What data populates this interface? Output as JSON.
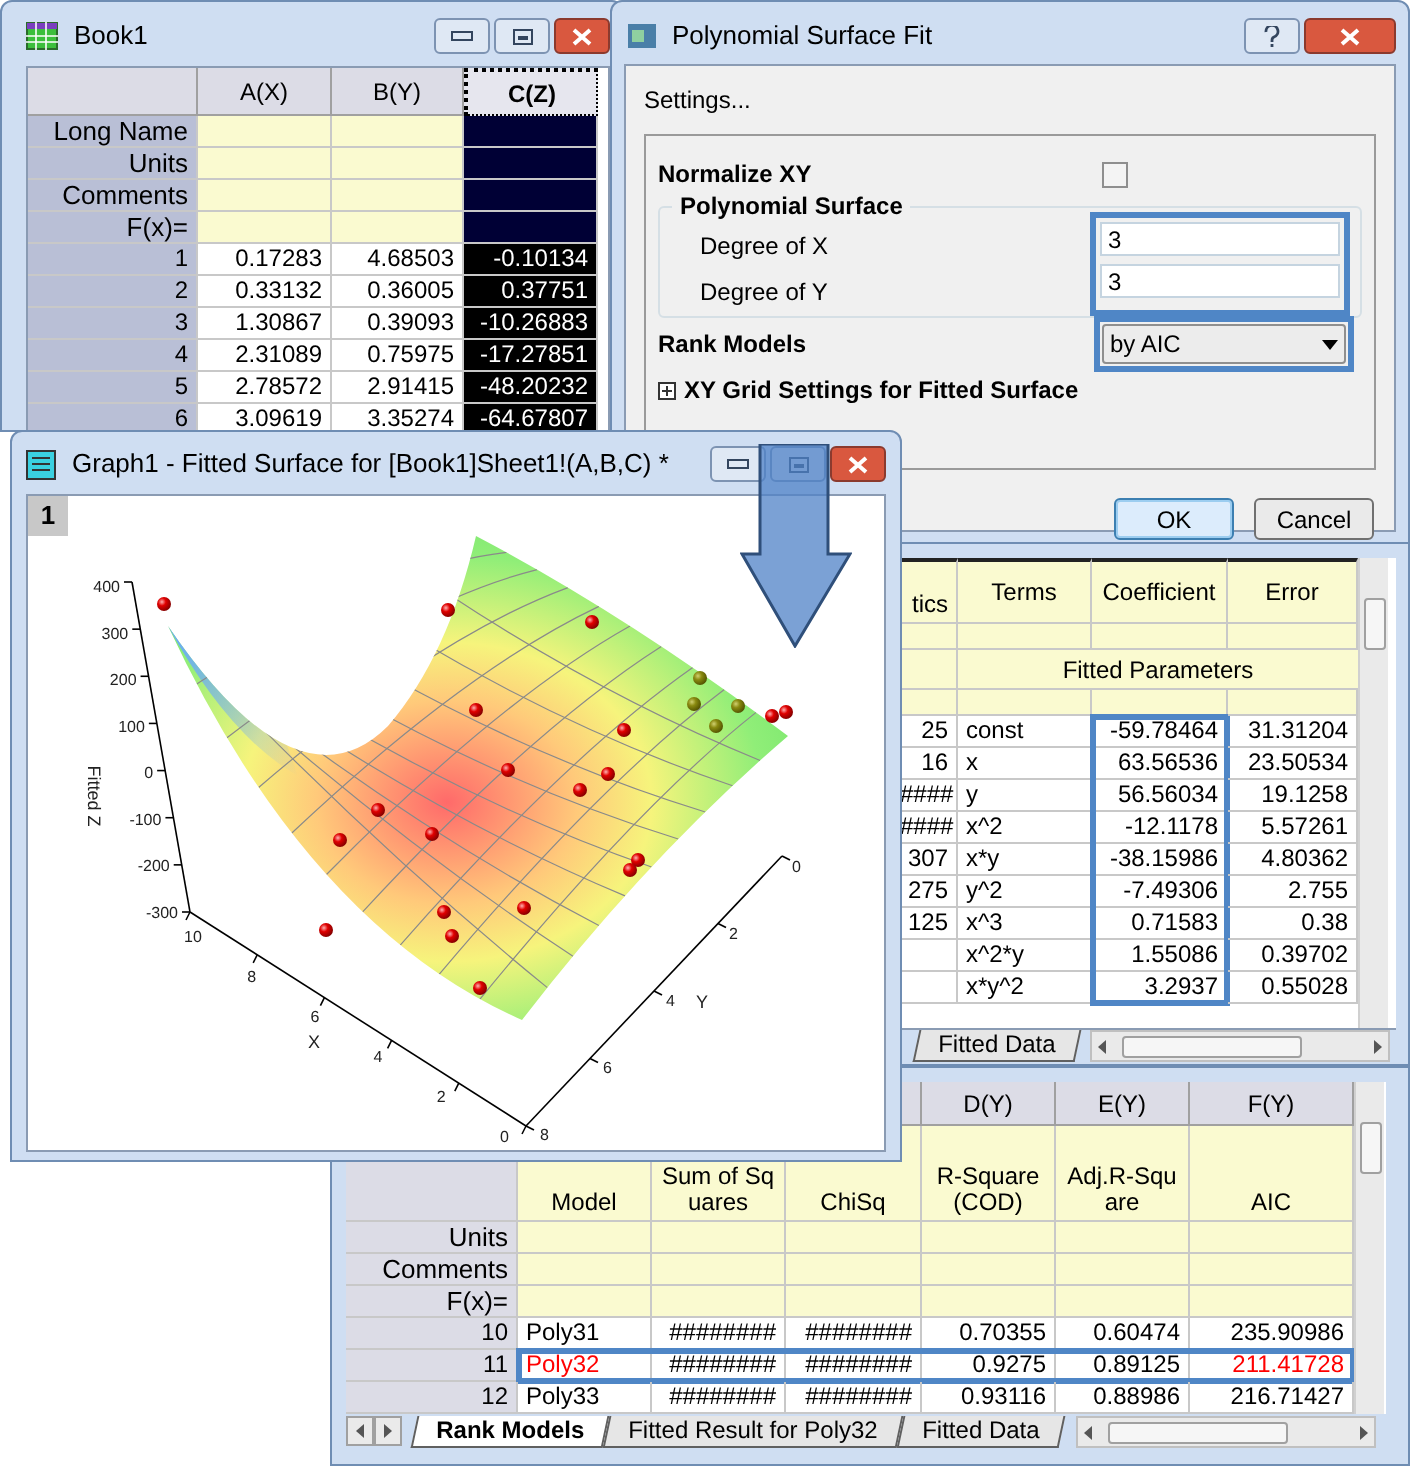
{
  "workbook": {
    "title": "Book1",
    "columns": [
      {
        "label": "A(X)",
        "selected": false
      },
      {
        "label": "B(Y)",
        "selected": false
      },
      {
        "label": "C(Z)",
        "selected": true
      }
    ],
    "label_rows": [
      "Long Name",
      "Units",
      "Comments",
      "F(x)="
    ],
    "rows": [
      {
        "index": "1",
        "cells": [
          "0.17283",
          "4.68503",
          "-0.10134"
        ]
      },
      {
        "index": "2",
        "cells": [
          "0.33132",
          "0.36005",
          "0.37751"
        ]
      },
      {
        "index": "3",
        "cells": [
          "1.30867",
          "0.39093",
          "-10.26883"
        ]
      },
      {
        "index": "4",
        "cells": [
          "2.31089",
          "0.75975",
          "-17.27851"
        ]
      },
      {
        "index": "5",
        "cells": [
          "2.78572",
          "2.91415",
          "-48.20232"
        ]
      },
      {
        "index": "6",
        "cells": [
          "3.09619",
          "3.35274",
          "-64.67807"
        ]
      }
    ]
  },
  "dialog": {
    "title": "Polynomial Surface Fit",
    "subtitle": "Settings...",
    "normalize": {
      "label": "Normalize XY",
      "checked": false
    },
    "group_title": "Polynomial Surface",
    "degree_fields": [
      {
        "label": "Degree of X",
        "value": "3"
      },
      {
        "label": "Degree of Y",
        "value": "3"
      }
    ],
    "degree_highlighted": true,
    "rank_models": {
      "label": "Rank Models",
      "value": "by AIC",
      "highlighted": true
    },
    "grid_settings": {
      "label": "XY Grid Settings for Fitted Surface",
      "expanded": false
    },
    "buttons": [
      {
        "label": "OK",
        "focused": true
      },
      {
        "label": "Cancel",
        "focused": false
      }
    ]
  },
  "graph": {
    "title": "Graph1 - Fitted Surface for [Book1]Sheet1!(A,B,C) *",
    "layer": "1",
    "z_axis": {
      "title": "Fitted Z",
      "ticks": [
        "400",
        "300",
        "200",
        "100",
        "0",
        "-100",
        "-200",
        "-300"
      ]
    },
    "x_axis": {
      "title": "X",
      "ticks": [
        "10",
        "8",
        "6",
        "4",
        "2",
        "0"
      ]
    },
    "y_axis": {
      "title": "Y",
      "ticks": [
        "0",
        "2",
        "4",
        "6",
        "8"
      ]
    }
  },
  "report": {
    "columns": [
      {
        "label": "tics",
        "highlighted": false
      },
      {
        "label": "Terms",
        "highlighted": false
      },
      {
        "label": "Coefficient",
        "highlighted": true
      },
      {
        "label": "Error",
        "highlighted": false
      }
    ],
    "section": "Fitted Parameters",
    "rows": [
      {
        "column_1": "25",
        "terms": "const",
        "coefficient": "-59.78464",
        "error": "31.31204"
      },
      {
        "column_1": "16",
        "terms": "x",
        "coefficient": "63.56536",
        "error": "23.50534"
      },
      {
        "column_1": "####",
        "terms": "y",
        "coefficient": "56.56034",
        "error": "19.1258"
      },
      {
        "column_1": "####",
        "terms": "x^2",
        "coefficient": "-12.1178",
        "error": "5.57261"
      },
      {
        "column_1": "307",
        "terms": "x*y",
        "coefficient": "-38.15986",
        "error": "4.80362"
      },
      {
        "column_1": "275",
        "terms": "y^2",
        "coefficient": "-7.49306",
        "error": "2.755"
      },
      {
        "column_1": "125",
        "terms": "x^3",
        "coefficient": "0.71583",
        "error": "0.38"
      },
      {
        "terms": "x^2*y",
        "coefficient": "1.55086",
        "error": "0.39702"
      },
      {
        "terms": "x*y^2",
        "coefficient": "3.2937",
        "error": "0.55028"
      }
    ],
    "tabs": [
      {
        "label": "Fitted Data",
        "selected": false
      }
    ]
  },
  "rank_sheet": {
    "columns": [
      "D(Y)",
      "E(Y)",
      "F(Y)"
    ],
    "long_names": [
      "Model",
      "Sum of Squares",
      "ChiSq",
      "R-Square(COD)",
      "Adj.R-Square",
      "AIC"
    ],
    "label_rows": [
      "Units",
      "Comments",
      "F(x)="
    ],
    "rows": [
      {
        "index": "10",
        "model": "Poly31",
        "sum_of_squares": "########",
        "chisq": "########",
        "r_square": "0.70355",
        "adj_r_square": "0.60474",
        "aic": "235.90986",
        "highlighted": false
      },
      {
        "index": "11",
        "model": "Poly32",
        "sum_of_squares": "########",
        "chisq": "########",
        "r_square": "0.9275",
        "adj_r_square": "0.89125",
        "aic": "211.41728",
        "highlighted": true
      },
      {
        "index": "12",
        "model": "Poly33",
        "sum_of_squares": "########",
        "chisq": "########",
        "r_square": "0.93116",
        "adj_r_square": "0.88986",
        "aic": "216.71427",
        "highlighted": false
      }
    ],
    "tabs": [
      {
        "label": "Rank Models",
        "selected": true
      },
      {
        "label": "Fitted Result for Poly32",
        "selected": false
      },
      {
        "label": "Fitted Data",
        "selected": false
      }
    ]
  }
}
